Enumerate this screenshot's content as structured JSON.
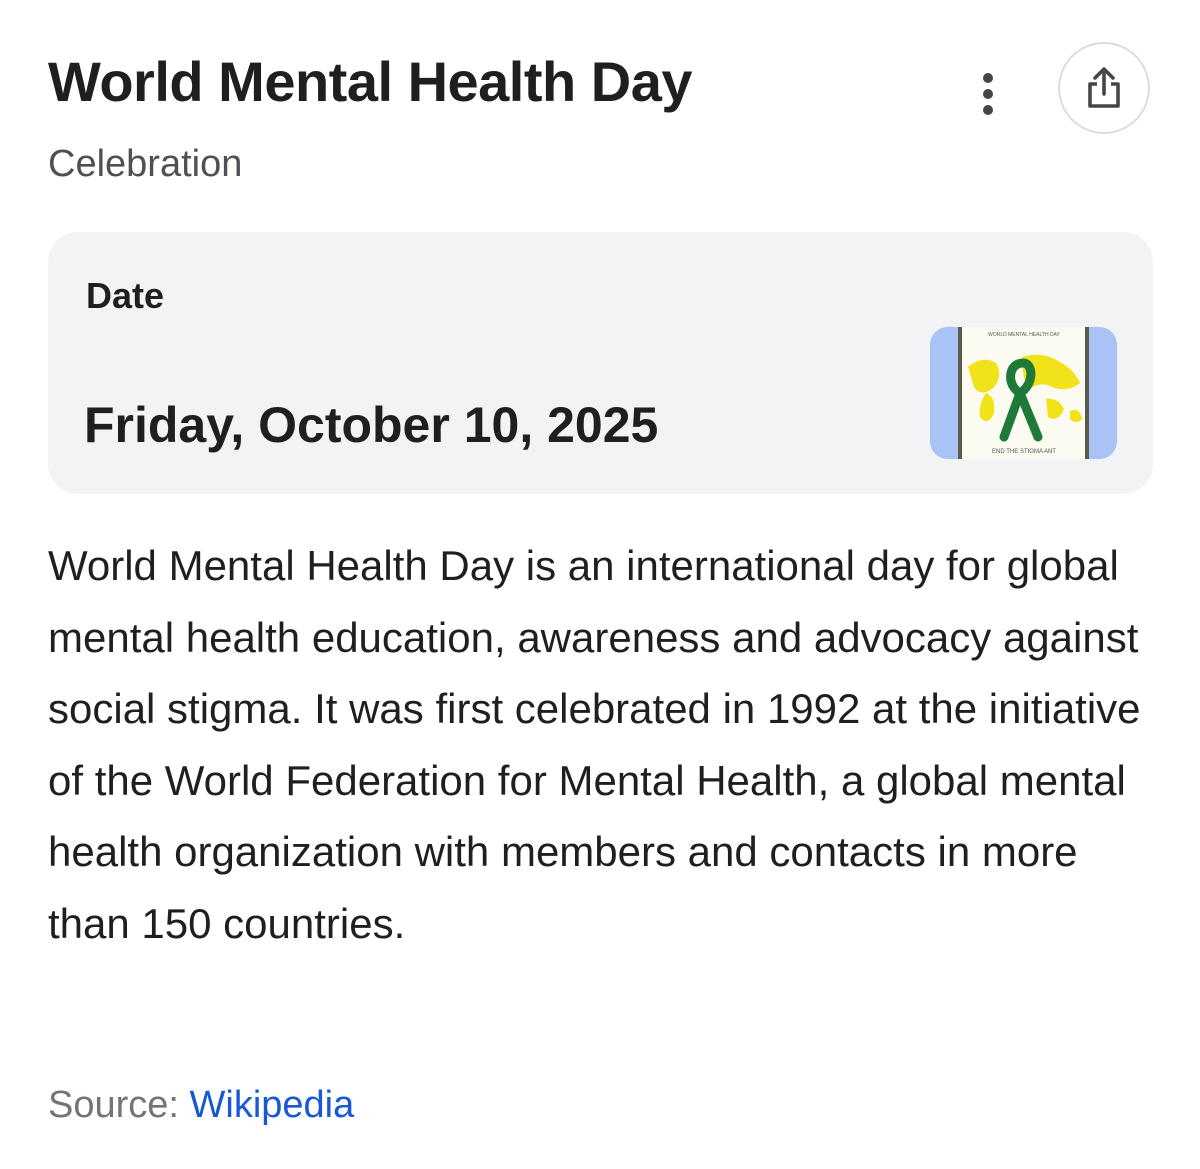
{
  "header": {
    "title": "World Mental Health Day",
    "subtitle": "Celebration",
    "more_icon": "more-vert-icon",
    "share_icon": "share-icon"
  },
  "date_card": {
    "label": "Date",
    "value": "Friday, October 10, 2025",
    "thumbnail": {
      "caption_top": "WORLD MENTAL HEALTH DAY",
      "caption_bottom": "END THE STIGMA ANT",
      "colors": {
        "background": "#a9c3f6",
        "poster": "#ffffff",
        "map": "#f4e41c",
        "ribbon": "#1f7a3a"
      }
    }
  },
  "description": "World Mental Health Day is an international day for global mental health education, awareness and advocacy against social stigma. It was first celebrated in 1992 at the initiative of the World Federation for Mental Health, a global mental health organization with members and contacts in more than 150 countries.",
  "source": {
    "label": "Source:",
    "link_text": "Wikipedia"
  },
  "colors": {
    "text": "#1f1f1f",
    "secondary_text": "#4d5156",
    "card_background": "#f1f3f4",
    "link": "#1a57d6"
  }
}
